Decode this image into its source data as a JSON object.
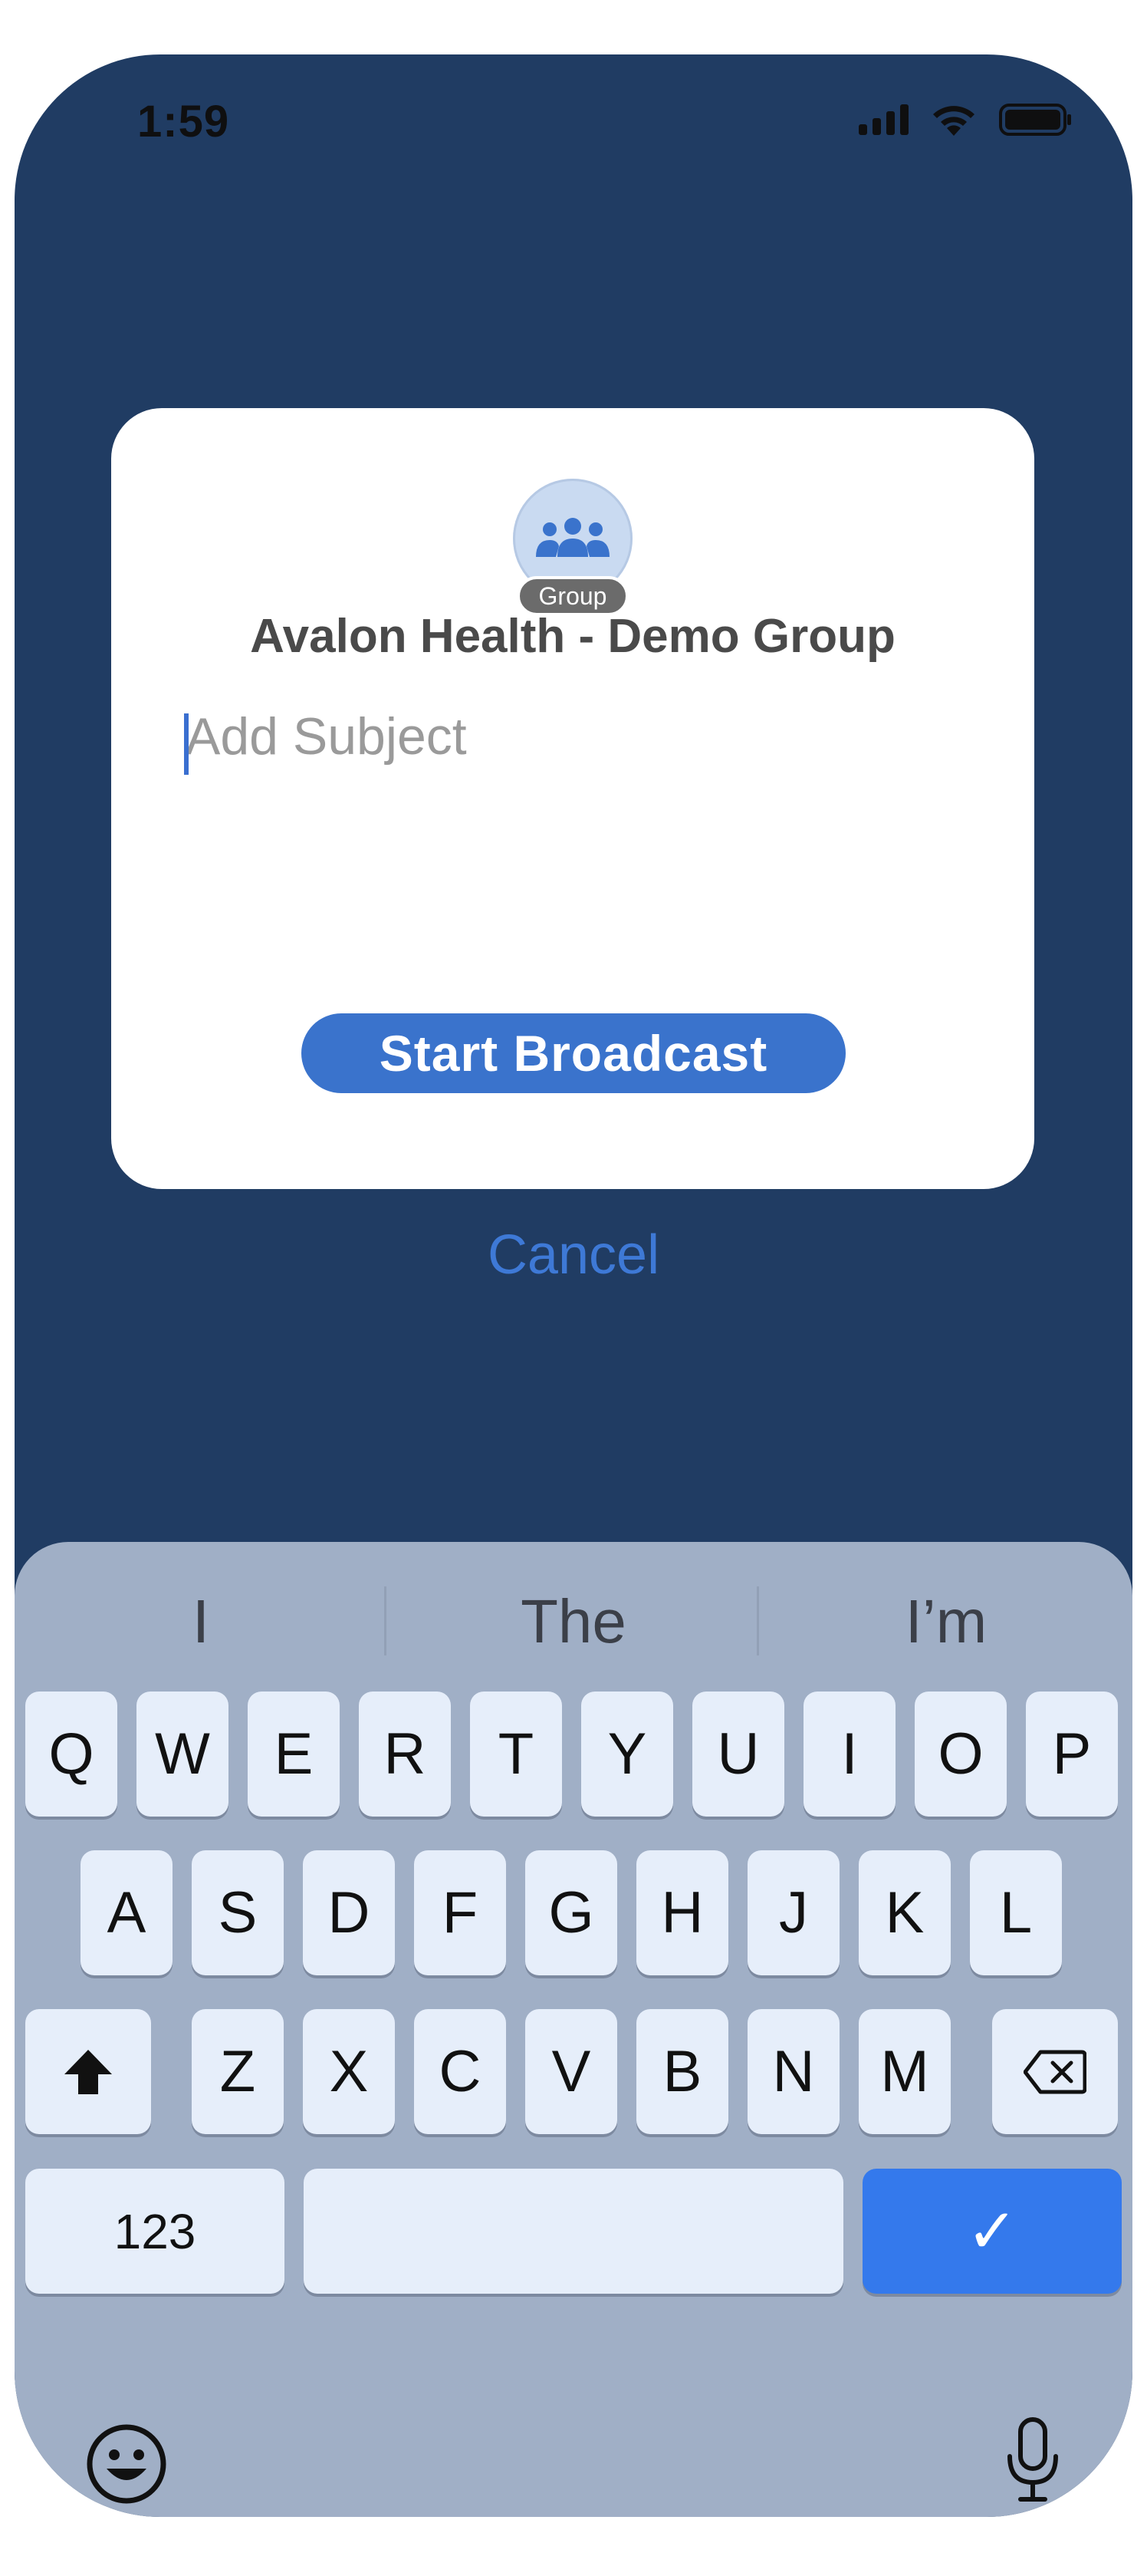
{
  "status_bar": {
    "time": "1:59",
    "icons": [
      "signal-icon",
      "wifi-icon",
      "battery-icon"
    ]
  },
  "modal": {
    "avatar_icon": "group-icon",
    "badge": "Group",
    "group_name": "Avalon Health - Demo Group",
    "subject_placeholder": "Add Subject",
    "subject_value": "",
    "start_button": "Start Broadcast"
  },
  "cancel_label": "Cancel",
  "keyboard": {
    "suggestions": [
      "I",
      "The",
      "I’m"
    ],
    "row1": [
      "Q",
      "W",
      "E",
      "R",
      "T",
      "Y",
      "U",
      "I",
      "O",
      "P"
    ],
    "row2": [
      "A",
      "S",
      "D",
      "F",
      "G",
      "H",
      "J",
      "K",
      "L"
    ],
    "row3": [
      "Z",
      "X",
      "C",
      "V",
      "B",
      "N",
      "M"
    ],
    "numbers_key": "123",
    "done_key": "✓",
    "shift_icon": "shift-icon",
    "backspace_icon": "backspace-icon",
    "emoji_icon": "emoji-icon",
    "mic_icon": "microphone-icon"
  },
  "colors": {
    "background": "#203c63",
    "accent": "#3a73cc",
    "link": "#3e79d6",
    "keyboard": "#a0afc6",
    "done_key": "#3479ec"
  }
}
